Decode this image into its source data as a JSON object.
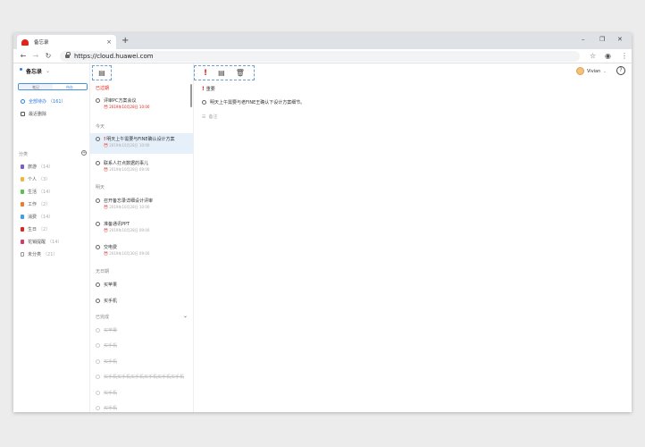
{
  "browser": {
    "tab_title": "备忘录",
    "tab_close": "×",
    "new_tab": "+",
    "win_min": "–",
    "win_max": "❐",
    "win_close": "✕",
    "back": "←",
    "forward": "→",
    "reload": "↻",
    "url": "https://cloud.huawei.com",
    "star": "☆",
    "account": "◉",
    "menu": "⋮"
  },
  "sidebar": {
    "title": "备忘录",
    "title_caret": "⌄",
    "tabs": [
      "笔记",
      "待办"
    ],
    "nav": [
      {
        "label": "全部待办",
        "count": "（161）"
      },
      {
        "label": "最近删除",
        "count": ""
      }
    ],
    "category_header": "分类",
    "category_add": "+",
    "categories": [
      {
        "label": "旅游",
        "count": "（14）",
        "color": "#7b5cd6"
      },
      {
        "label": "个人",
        "count": "（3）",
        "color": "#f2b632"
      },
      {
        "label": "生活",
        "count": "（14）",
        "color": "#5bbf4e"
      },
      {
        "label": "工作",
        "count": "（2）",
        "color": "#f07a2a"
      },
      {
        "label": "消费",
        "count": "（14）",
        "color": "#3aa0e8"
      },
      {
        "label": "生日",
        "count": "（2）",
        "color": "#e2231a"
      },
      {
        "label": "花销提醒",
        "count": "（14）",
        "color": "#d23c6a"
      },
      {
        "label": "未分类",
        "count": "（21）",
        "color": "#999999"
      }
    ]
  },
  "list": {
    "tool_icon": "▤",
    "groups": {
      "overdue": "已过期",
      "today": "今天",
      "tomorrow": "明天",
      "nodate": "无日期",
      "completed": "已完成"
    },
    "collapse": "⌄",
    "overdue_items": [
      {
        "title": "评审PC方案会议",
        "date": "2019年10月28日 10:00"
      }
    ],
    "today_items": [
      {
        "title": "明天上午需要与FINE确认设计方案",
        "date": "2019年10月28日 10:00",
        "important": "!"
      },
      {
        "title": "联系人打点数据的事儿",
        "date": "2019年10月28日 09:00"
      }
    ],
    "tomorrow_items": [
      {
        "title": "召开备忘录详细设计评审",
        "date": "2019年10月28日 10:00"
      },
      {
        "title": "准备通讯PPT",
        "date": "2019年10月28日 09:00"
      },
      {
        "title": "交电费",
        "date": "2019年10月30日 09:00"
      }
    ],
    "nodate_items": [
      {
        "title": "买苹果"
      },
      {
        "title": "买手机"
      }
    ],
    "completed_items": [
      {
        "title": "买苹果"
      },
      {
        "title": "买手机"
      },
      {
        "title": "买手机"
      },
      {
        "title": "买手机买手机买手机买手机买手机买手机"
      },
      {
        "title": "买手机"
      },
      {
        "title": "买手机"
      }
    ]
  },
  "detail": {
    "tool_important": "!",
    "tool_note": "▤",
    "tool_delete": "🗑",
    "user_name": "Vivian",
    "user_caret": "⌄",
    "help": "?",
    "important_label": "重要",
    "task_text": "明天上午需要与老FINE王确认下设计方案细节。",
    "note_label": "备注",
    "note_icon": "☰"
  }
}
